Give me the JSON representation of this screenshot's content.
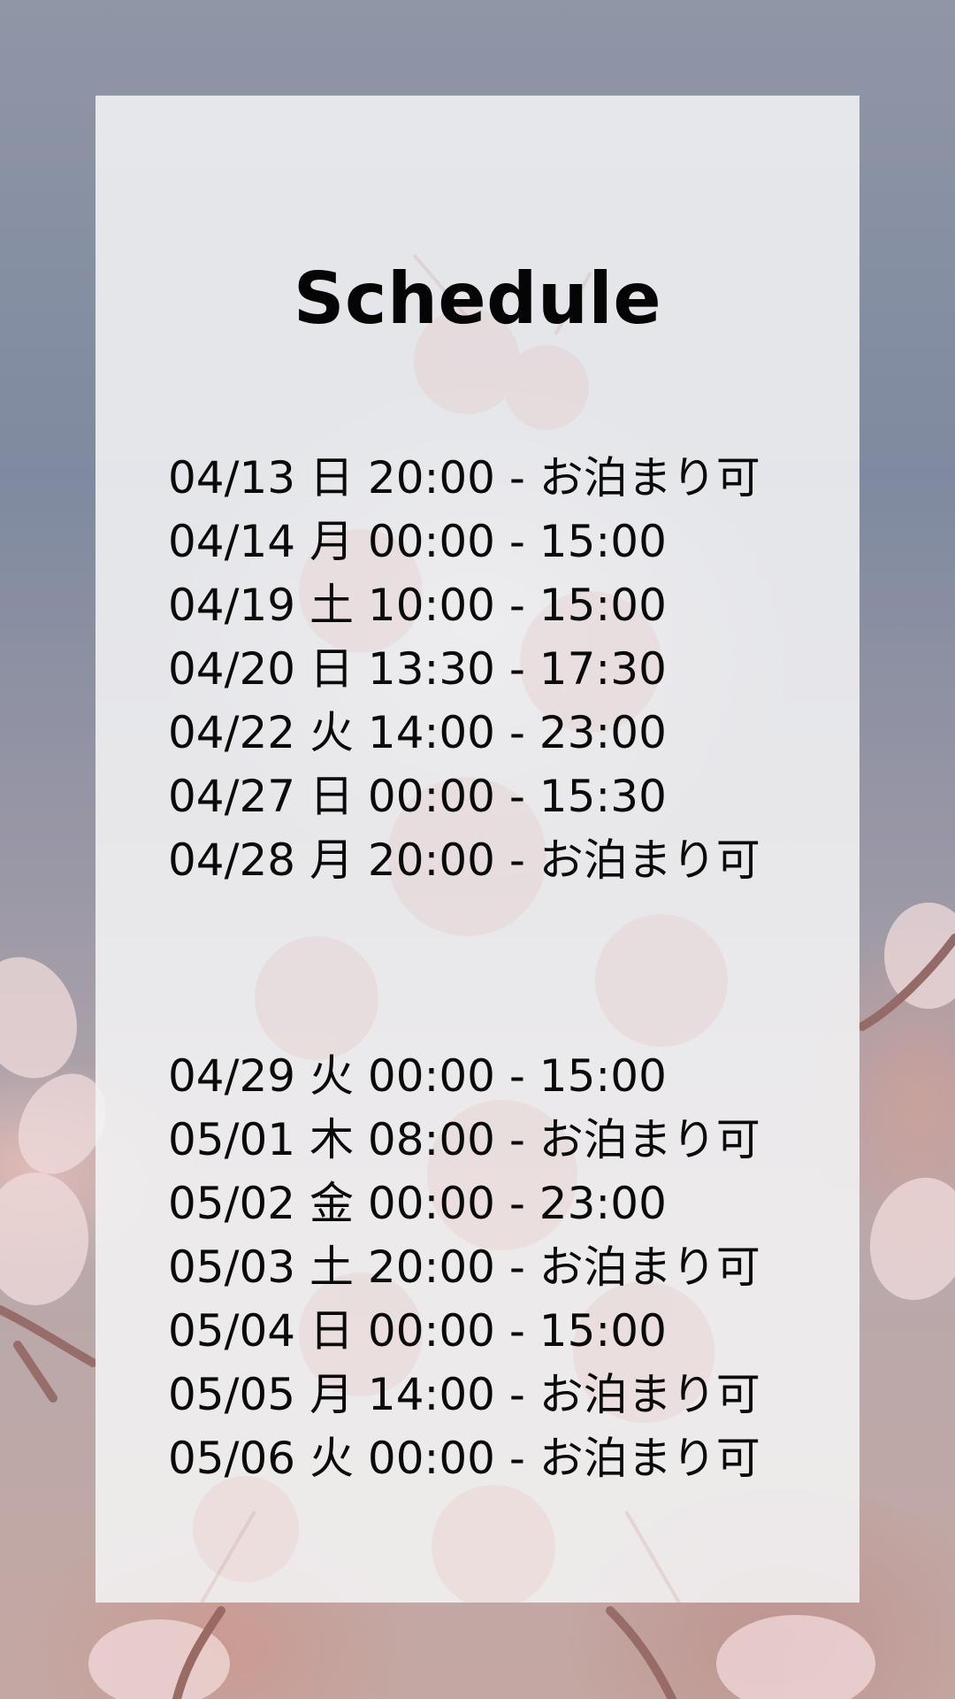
{
  "title": "Schedule",
  "group1": [
    "04/13 日 20:00 - お泊まり可",
    "04/14 月 00:00 - 15:00",
    "04/19 土 10:00 - 15:00",
    "04/20 日 13:30 - 17:30",
    "04/22 火 14:00 - 23:00",
    "04/27 日 00:00 - 15:30",
    "04/28 月 20:00 - お泊まり可"
  ],
  "group2": [
    "04/29 火 00:00 - 15:00",
    "05/01 木 08:00 - お泊まり可",
    "05/02 金 00:00 - 23:00",
    "05/03 土 20:00 - お泊まり可",
    "05/04 日 00:00 - 15:00",
    "05/05 月 14:00 - お泊まり可",
    "05/06 火 00:00 - お泊まり可"
  ],
  "colors": {
    "card": "#f4f4f6",
    "text": "#0a0a0a",
    "blossom": "#e6c2bd"
  },
  "background_image": "cherry-blossom-photo"
}
